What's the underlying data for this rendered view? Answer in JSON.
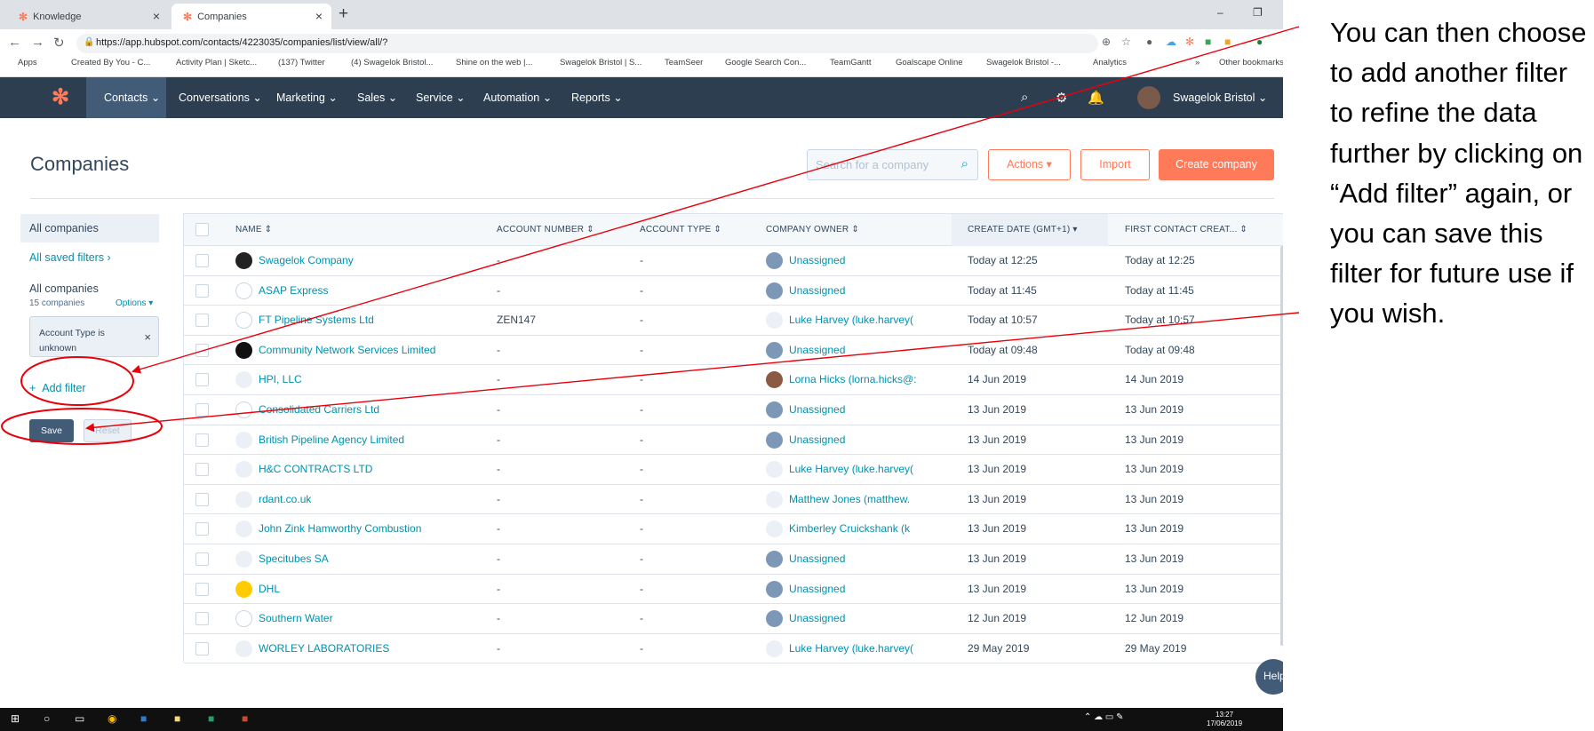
{
  "browser": {
    "tabs": [
      {
        "label": "Knowledge",
        "active": false
      },
      {
        "label": "Companies",
        "active": true
      }
    ],
    "new_tab": "+",
    "url": "https://app.hubspot.com/contacts/4223035/companies/list/view/all/?",
    "bookmarks": [
      "Apps",
      "Created By You - C...",
      "Activity Plan | Sketc...",
      "(137) Twitter",
      "(4) Swagelok Bristol...",
      "Shine on the web |...",
      "Swagelok Bristol | S...",
      "TeamSeer",
      "Google Search Con...",
      "TeamGantt",
      "Goalscape Online",
      "Swagelok Bristol -...",
      "Analytics",
      "»",
      "Other bookmarks"
    ]
  },
  "hubspot_nav": {
    "logo": "HubSpot",
    "items": [
      "Contacts",
      "Conversations",
      "Marketing",
      "Sales",
      "Service",
      "Automation",
      "Reports"
    ],
    "account_name": "Swagelok Bristol"
  },
  "page": {
    "title": "Companies",
    "search_placeholder": "Search for a company",
    "actions_label": "Actions",
    "import_label": "Import",
    "create_label": "Create company"
  },
  "sidebar": {
    "all_companies_tab": "All companies",
    "saved_filters": "All saved filters",
    "view_name": "All companies",
    "count": "15 companies",
    "options": "Options",
    "filter_line1": "Account Type is",
    "filter_line2": "unknown",
    "add_filter": "Add filter",
    "save": "Save",
    "reset": "Reset"
  },
  "table": {
    "columns": [
      "NAME",
      "ACCOUNT NUMBER",
      "ACCOUNT TYPE",
      "COMPANY OWNER",
      "CREATE DATE (GMT+1)",
      "FIRST CONTACT CREAT..."
    ],
    "rows": [
      {
        "name": "Swagelok Company",
        "account_number": "-",
        "account_type": "-",
        "owner": "Unassigned",
        "create_date": "Today at 12:25",
        "first_contact": "Today at 12:25",
        "logo": "Swagelok",
        "owner_avatar": "default"
      },
      {
        "name": "ASAP Express",
        "account_number": "-",
        "account_type": "-",
        "owner": "Unassigned",
        "create_date": "Today at 11:45",
        "first_contact": "Today at 11:45",
        "logo": "asap",
        "owner_avatar": "default"
      },
      {
        "name": "FT Pipeline Systems Ltd",
        "account_number": "ZEN147",
        "account_type": "-",
        "owner": "Luke Harvey (luke.harvey(",
        "create_date": "Today at 10:57",
        "first_contact": "Today at 10:57",
        "logo": "ft",
        "owner_avatar": "ghost"
      },
      {
        "name": "Community Network Services Limited",
        "account_number": "-",
        "account_type": "-",
        "owner": "Unassigned",
        "create_date": "Today at 09:48",
        "first_contact": "Today at 09:48",
        "logo": "CNSL",
        "owner_avatar": "default"
      },
      {
        "name": "HPI, LLC",
        "account_number": "-",
        "account_type": "-",
        "owner": "Lorna Hicks (lorna.hicks@:",
        "create_date": "14 Jun 2019",
        "first_contact": "14 Jun 2019",
        "logo": "",
        "owner_avatar": "photo"
      },
      {
        "name": "Consolidated Carriers Ltd",
        "account_number": "-",
        "account_type": "-",
        "owner": "Unassigned",
        "create_date": "13 Jun 2019",
        "first_contact": "13 Jun 2019",
        "logo": "ccl",
        "owner_avatar": "default"
      },
      {
        "name": "British Pipeline Agency Limited",
        "account_number": "-",
        "account_type": "-",
        "owner": "Unassigned",
        "create_date": "13 Jun 2019",
        "first_contact": "13 Jun 2019",
        "logo": "",
        "owner_avatar": "default"
      },
      {
        "name": "H&C CONTRACTS LTD",
        "account_number": "-",
        "account_type": "-",
        "owner": "Luke Harvey (luke.harvey(",
        "create_date": "13 Jun 2019",
        "first_contact": "13 Jun 2019",
        "logo": "",
        "owner_avatar": "ghost"
      },
      {
        "name": "rdant.co.uk",
        "account_number": "-",
        "account_type": "-",
        "owner": "Matthew Jones (matthew.",
        "create_date": "13 Jun 2019",
        "first_contact": "13 Jun 2019",
        "logo": "",
        "owner_avatar": "ghost"
      },
      {
        "name": "John Zink Hamworthy Combustion",
        "account_number": "-",
        "account_type": "-",
        "owner": "Kimberley Cruickshank (k",
        "create_date": "13 Jun 2019",
        "first_contact": "13 Jun 2019",
        "logo": "",
        "owner_avatar": "ghost"
      },
      {
        "name": "Specitubes SA",
        "account_number": "-",
        "account_type": "-",
        "owner": "Unassigned",
        "create_date": "13 Jun 2019",
        "first_contact": "13 Jun 2019",
        "logo": "",
        "owner_avatar": "default"
      },
      {
        "name": "DHL",
        "account_number": "-",
        "account_type": "-",
        "owner": "Unassigned",
        "create_date": "13 Jun 2019",
        "first_contact": "13 Jun 2019",
        "logo": "dhl",
        "owner_avatar": "default"
      },
      {
        "name": "Southern Water",
        "account_number": "-",
        "account_type": "-",
        "owner": "Unassigned",
        "create_date": "12 Jun 2019",
        "first_contact": "12 Jun 2019",
        "logo": "sw",
        "owner_avatar": "default"
      },
      {
        "name": "WORLEY LABORATORIES",
        "account_number": "-",
        "account_type": "-",
        "owner": "Luke Harvey (luke.harvey(",
        "create_date": "29 May 2019",
        "first_contact": "29 May 2019",
        "logo": "",
        "owner_avatar": "ghost"
      }
    ]
  },
  "help_label": "Help",
  "taskbar": {
    "time": "13:27",
    "date": "17/06/2019"
  },
  "annotation": {
    "caption": "You can then choose to add another filter to refine the data further by clicking on “Add filter” again, or you can save this filter for future use if you wish.",
    "arrow_color": "#e8000b"
  }
}
